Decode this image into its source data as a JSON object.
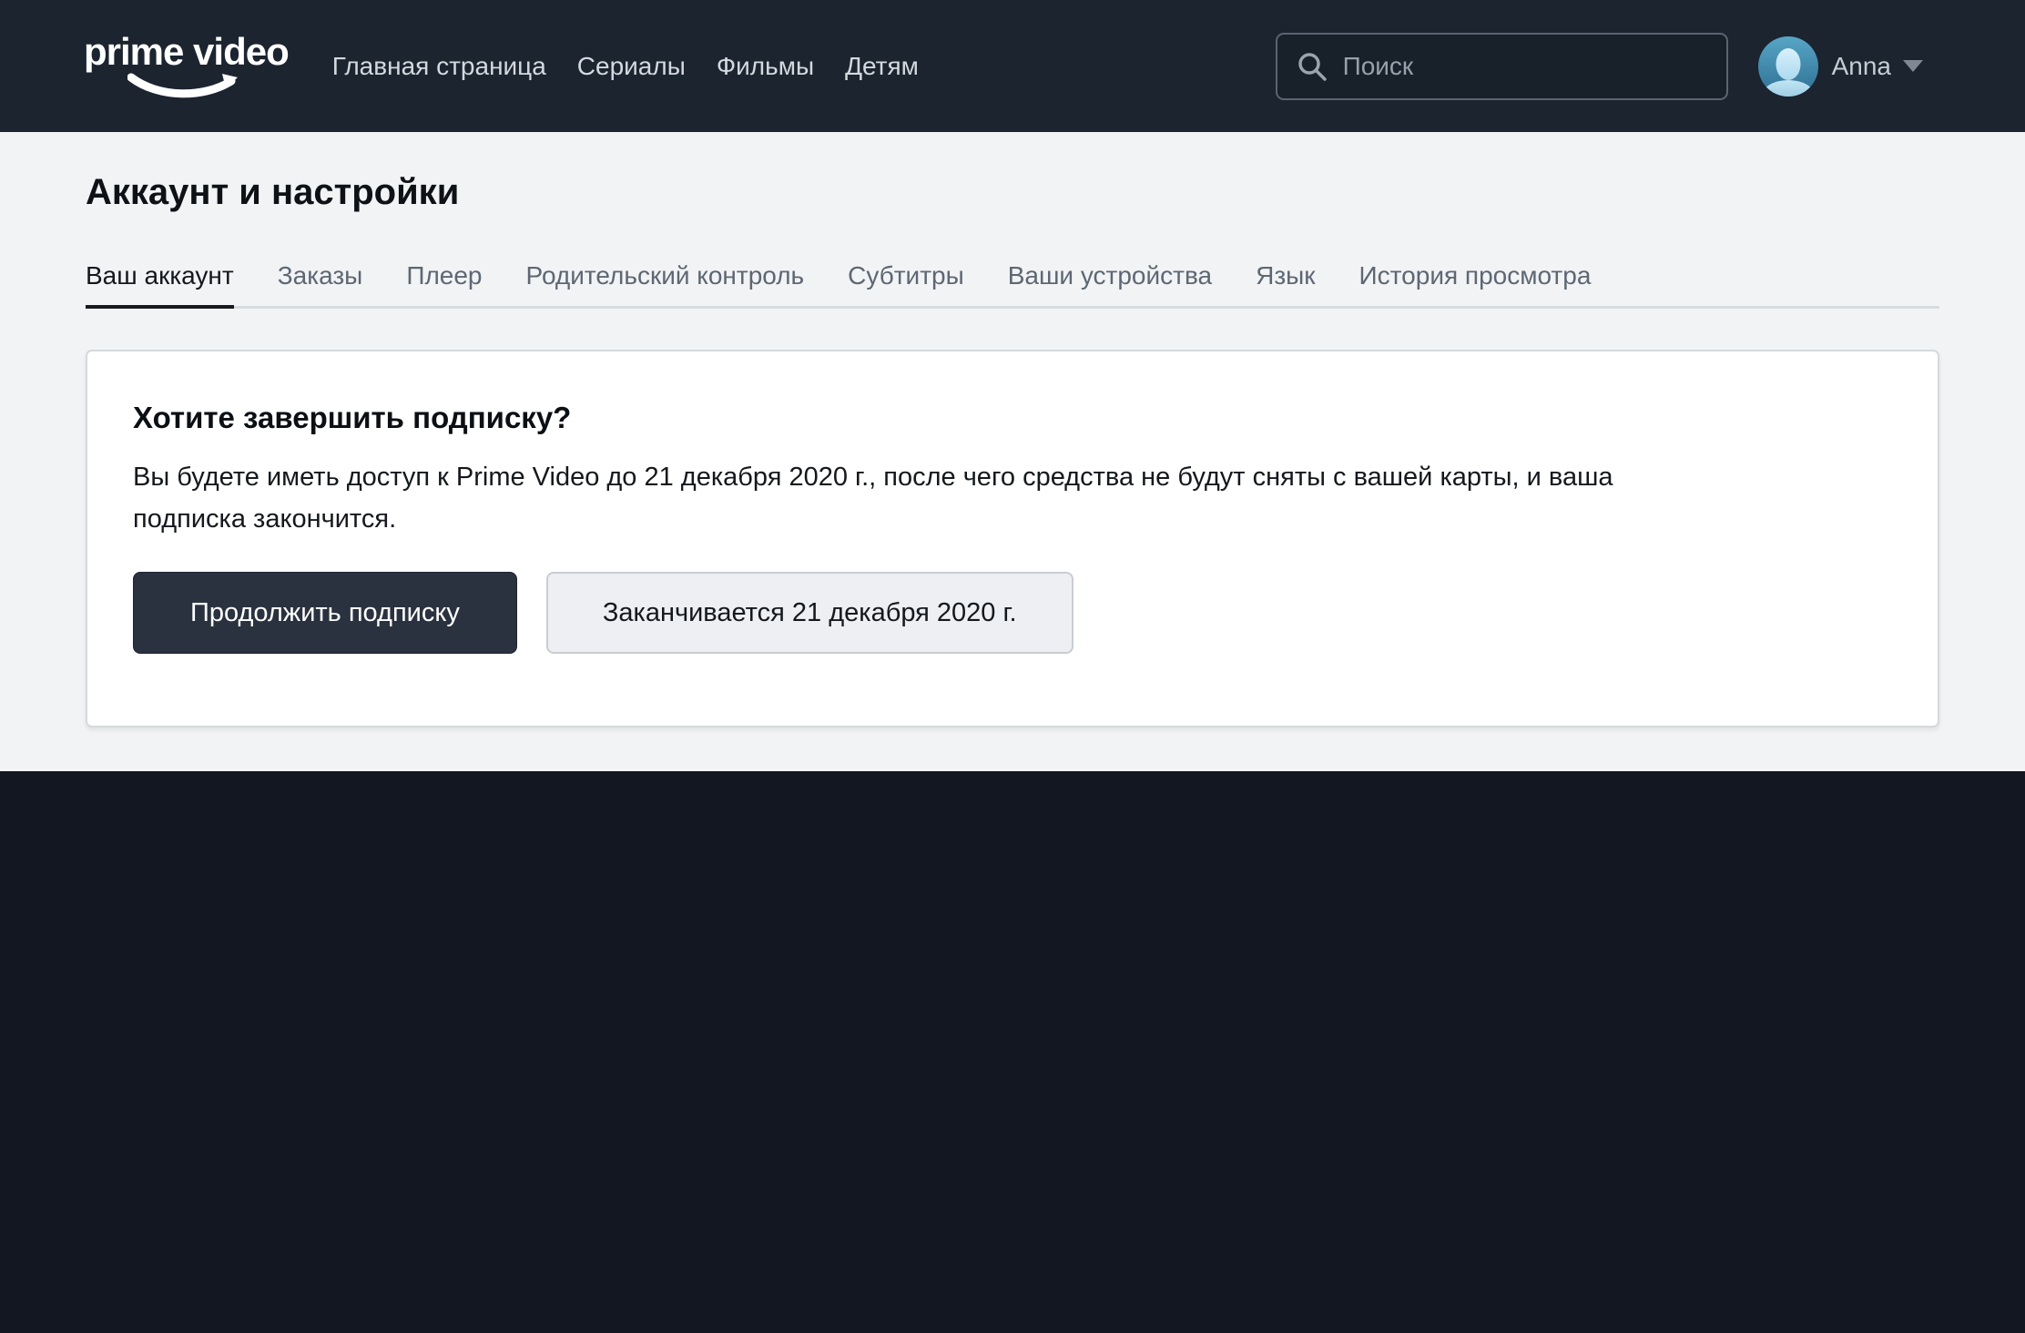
{
  "brand": {
    "logo_text": "prime video"
  },
  "header": {
    "nav": [
      {
        "label": "Главная страница"
      },
      {
        "label": "Сериалы"
      },
      {
        "label": "Фильмы"
      },
      {
        "label": "Детям"
      }
    ],
    "search": {
      "placeholder": "Поиск",
      "value": ""
    },
    "profile": {
      "name": "Anna"
    }
  },
  "page": {
    "title": "Аккаунт и настройки",
    "tabs": [
      {
        "label": "Ваш аккаунт",
        "active": true
      },
      {
        "label": "Заказы",
        "active": false
      },
      {
        "label": "Плеер",
        "active": false
      },
      {
        "label": "Родительский контроль",
        "active": false
      },
      {
        "label": "Субтитры",
        "active": false
      },
      {
        "label": "Ваши устройства",
        "active": false
      },
      {
        "label": "Язык",
        "active": false
      },
      {
        "label": "История просмотра",
        "active": false
      }
    ],
    "card": {
      "heading": "Хотите завершить подписку?",
      "body": "Вы будете иметь доступ к Prime Video до 21 декабря 2020 г., после чего средства не будут сняты с вашей карты, и ваша\nподписка закончится.",
      "primary_button": "Продолжить подписку",
      "secondary_button": "Заканчивается 21 декабря 2020 г."
    }
  },
  "icons": {
    "search": "search-icon",
    "profile_caret": "chevron-down-icon",
    "logo_arrow": "smile-arrow-icon"
  },
  "colors": {
    "header_bg": "#1b242f",
    "footer_bg": "#121722",
    "page_bg": "#f2f3f5",
    "card_bg": "#ffffff",
    "card_border": "#d5d9de",
    "primary_btn_bg": "#2a323f",
    "primary_btn_text": "#ffffff",
    "secondary_btn_bg": "#edeff2",
    "secondary_btn_border": "#c9cdd3",
    "tab_inactive": "#5d6773",
    "tab_active": "#14171d",
    "tab_divider": "#d9dcdf",
    "nav_link": "#d3d9df",
    "text_dark": "#15181d"
  }
}
